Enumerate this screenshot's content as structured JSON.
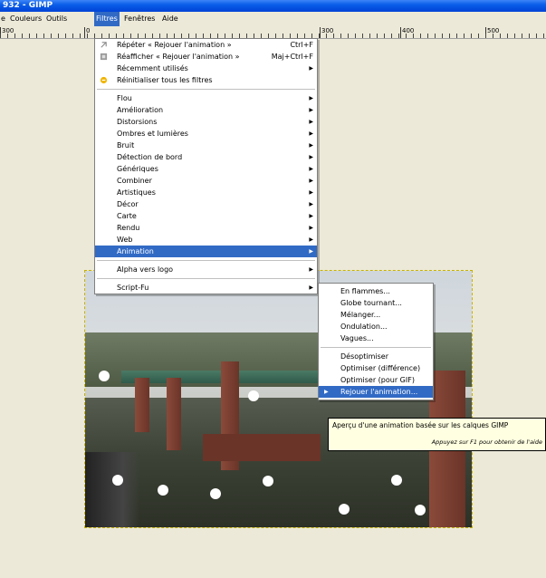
{
  "window": {
    "title": "932 - GIMP"
  },
  "menubar": {
    "items": [
      {
        "label": "e"
      },
      {
        "label": "Couleurs"
      },
      {
        "label": "Outils"
      },
      {
        "label": "Filtres"
      },
      {
        "label": "Fenêtres"
      },
      {
        "label": "Aide"
      }
    ]
  },
  "ruler": {
    "labels": [
      "300",
      "0",
      "300",
      "400",
      "500"
    ]
  },
  "filters_menu": {
    "top_items": [
      {
        "label": "Répéter « Rejouer l'animation »",
        "accel": "Ctrl+F",
        "icon": "repeat-icon"
      },
      {
        "label": "Réafficher « Rejouer l'animation »",
        "accel": "Maj+Ctrl+F",
        "icon": "reshow-icon"
      },
      {
        "label": "Récemment utilisés",
        "submenu": true
      },
      {
        "label": "Réinitialiser tous les filtres",
        "icon": "reset-icon"
      }
    ],
    "categories": [
      "Flou",
      "Amélioration",
      "Distorsions",
      "Ombres et lumières",
      "Bruit",
      "Détection de bord",
      "Génériques",
      "Combiner",
      "Artistiques",
      "Décor",
      "Carte",
      "Rendu",
      "Web",
      "Animation"
    ],
    "active_category": "Animation",
    "extra_items": [
      "Alpha vers logo",
      "Script-Fu"
    ]
  },
  "animation_submenu": {
    "group1": [
      "En flammes...",
      "Globe tournant...",
      "Mélanger...",
      "Ondulation...",
      "Vagues..."
    ],
    "group2": [
      "Désoptimiser",
      "Optimiser (différence)",
      "Optimiser (pour GIF)",
      "Rejouer l'animation..."
    ],
    "highlighted": "Rejouer l'animation..."
  },
  "tooltip": {
    "text": "Aperçu d'une animation basée sur les calques GIMP",
    "hint": "Appuyez sur F1 pour obtenir de l'aide"
  },
  "colors": {
    "highlight": "#316ac5",
    "title_bar": "#0a5ee8",
    "tooltip_bg": "#ffffe1"
  }
}
